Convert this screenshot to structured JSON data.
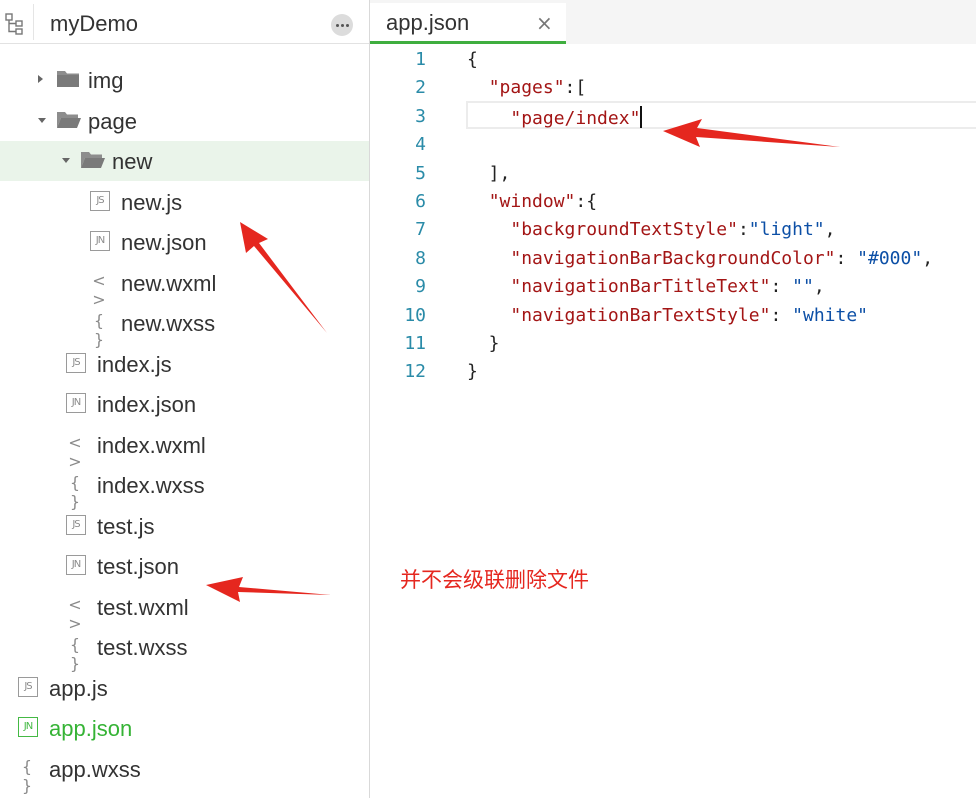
{
  "sidebar": {
    "project_name": "myDemo",
    "tree": [
      {
        "name": "img",
        "kind": "folder",
        "expanded": false
      },
      {
        "name": "page",
        "kind": "folder",
        "expanded": true
      },
      {
        "name": "new",
        "kind": "folder",
        "expanded": true,
        "selected": true
      },
      {
        "name": "new.js",
        "kind": "js",
        "badge": "JS"
      },
      {
        "name": "new.json",
        "kind": "json",
        "badge": "JN"
      },
      {
        "name": "new.wxml",
        "kind": "wxml",
        "badge": "< >"
      },
      {
        "name": "new.wxss",
        "kind": "wxss",
        "badge": "{ }"
      },
      {
        "name": "index.js",
        "kind": "js",
        "badge": "JS"
      },
      {
        "name": "index.json",
        "kind": "json",
        "badge": "JN"
      },
      {
        "name": "index.wxml",
        "kind": "wxml",
        "badge": "< >"
      },
      {
        "name": "index.wxss",
        "kind": "wxss",
        "badge": "{ }"
      },
      {
        "name": "test.js",
        "kind": "js",
        "badge": "JS"
      },
      {
        "name": "test.json",
        "kind": "json",
        "badge": "JN"
      },
      {
        "name": "test.wxml",
        "kind": "wxml",
        "badge": "< >"
      },
      {
        "name": "test.wxss",
        "kind": "wxss",
        "badge": "{ }"
      },
      {
        "name": "app.js",
        "kind": "js",
        "badge": "JS"
      },
      {
        "name": "app.json",
        "kind": "json",
        "badge": "JN",
        "active": true
      },
      {
        "name": "app.wxss",
        "kind": "wxss",
        "badge": "{ }"
      }
    ]
  },
  "editor": {
    "tab_title": "app.json",
    "close_glyph": "×",
    "lines": [
      {
        "n": "1",
        "parts": [
          {
            "t": "{",
            "c": "p"
          }
        ]
      },
      {
        "n": "2",
        "parts": [
          {
            "t": "  ",
            "c": "p"
          },
          {
            "t": "\"pages\"",
            "c": "k"
          },
          {
            "t": ":[",
            "c": "p"
          }
        ]
      },
      {
        "n": "3",
        "parts": [
          {
            "t": "    ",
            "c": "p"
          },
          {
            "t": "\"page/index\"",
            "c": "k"
          }
        ],
        "caret": true
      },
      {
        "n": "4",
        "parts": []
      },
      {
        "n": "5",
        "parts": [
          {
            "t": "  ],",
            "c": "p"
          }
        ]
      },
      {
        "n": "6",
        "parts": [
          {
            "t": "  ",
            "c": "p"
          },
          {
            "t": "\"window\"",
            "c": "k"
          },
          {
            "t": ":{",
            "c": "p"
          }
        ]
      },
      {
        "n": "7",
        "parts": [
          {
            "t": "    ",
            "c": "p"
          },
          {
            "t": "\"backgroundTextStyle\"",
            "c": "k"
          },
          {
            "t": ":",
            "c": "p"
          },
          {
            "t": "\"light\"",
            "c": "v"
          },
          {
            "t": ",",
            "c": "p"
          }
        ]
      },
      {
        "n": "8",
        "parts": [
          {
            "t": "    ",
            "c": "p"
          },
          {
            "t": "\"navigationBarBackgroundColor\"",
            "c": "k"
          },
          {
            "t": ": ",
            "c": "p"
          },
          {
            "t": "\"#000\"",
            "c": "v"
          },
          {
            "t": ",",
            "c": "p"
          }
        ]
      },
      {
        "n": "9",
        "parts": [
          {
            "t": "    ",
            "c": "p"
          },
          {
            "t": "\"navigationBarTitleText\"",
            "c": "k"
          },
          {
            "t": ": ",
            "c": "p"
          },
          {
            "t": "\"\"",
            "c": "v"
          },
          {
            "t": ",",
            "c": "p"
          }
        ]
      },
      {
        "n": "10",
        "parts": [
          {
            "t": "    ",
            "c": "p"
          },
          {
            "t": "\"navigationBarTextStyle\"",
            "c": "k"
          },
          {
            "t": ": ",
            "c": "p"
          },
          {
            "t": "\"white\"",
            "c": "v"
          }
        ]
      },
      {
        "n": "11",
        "parts": [
          {
            "t": "  }",
            "c": "p"
          }
        ]
      },
      {
        "n": "12",
        "parts": [
          {
            "t": "}",
            "c": "p"
          }
        ]
      }
    ]
  },
  "annotation": {
    "note": "并不会级联删除文件",
    "color": "#e5271f"
  },
  "colors": {
    "accent_green": "#3fae3f",
    "selected_row": "#eaf4ea"
  }
}
